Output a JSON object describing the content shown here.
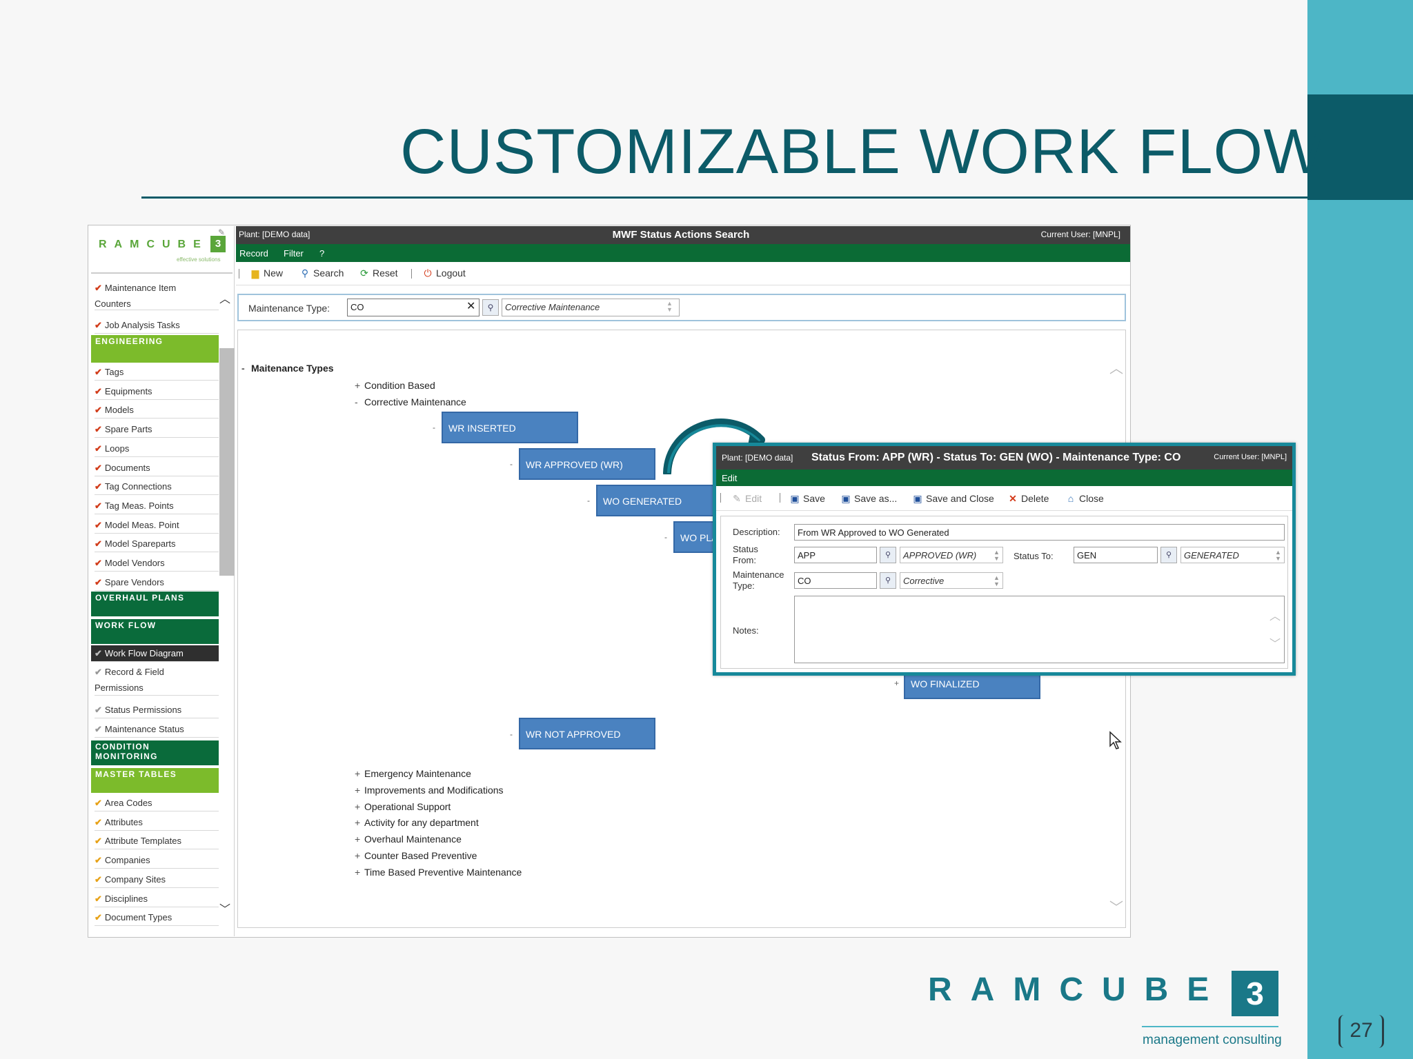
{
  "slide": {
    "title": "CUSTOMIZABLE WORK FLOW",
    "footer_logo_letters": "RAMCUBE",
    "footer_logo_cube": "3",
    "footer_tagline": "management consulting",
    "page_number": "27"
  },
  "colors": {
    "teal_dark": "#0c5b68",
    "teal_light": "#4db6c6",
    "green_dark": "#0b6b35",
    "green_light": "#7cbb2b",
    "node_blue": "#4a82c0"
  },
  "sidebar": {
    "logo_letters": "RAMCUBE",
    "logo_cube": "3",
    "logo_tag": "effective solutions",
    "items_top": [
      {
        "label": "Maintenance Item",
        "label2": "Counters"
      },
      {
        "label": "Job Analysis Tasks"
      }
    ],
    "engineering_heading": "ENGINEERING",
    "engineering_items": [
      "Tags",
      "Equipments",
      "Models",
      "Spare Parts",
      "Loops",
      "Documents",
      "Tag Connections",
      "Tag Meas. Points",
      "Model Meas. Point",
      "Model Spareparts",
      "Model Vendors",
      "Spare Vendors"
    ],
    "overhaul_heading": "OVERHAUL PLANS",
    "workflow_heading": "WORK FLOW",
    "workflow_items": [
      {
        "label": "Work Flow Diagram"
      },
      {
        "label": "Record & Field",
        "label2": "Permissions"
      },
      {
        "label": "Status Permissions"
      },
      {
        "label": "Maintenance Status"
      }
    ],
    "condition_heading_line1": "CONDITION",
    "condition_heading_line2": "MONITORING",
    "master_heading": "MASTER TABLES",
    "master_items": [
      "Area Codes",
      "Attributes",
      "Attribute Templates",
      "Companies",
      "Company Sites",
      "Disciplines",
      "Document Types"
    ]
  },
  "app": {
    "plant": "Plant: [DEMO data]",
    "title": "MWF Status Actions Search",
    "user": "Current User: [MNPL]",
    "menu": [
      "Record",
      "Filter",
      "?"
    ],
    "toolbar": {
      "new": "New",
      "search": "Search",
      "reset": "Reset",
      "logout": "Logout"
    },
    "filter": {
      "label": "Maintenance Type:",
      "code": "CO",
      "description": "Corrective Maintenance"
    }
  },
  "tree": {
    "root": "Maitenance Types",
    "condition_based": "Condition Based",
    "corrective": "Corrective Maintenance",
    "nodes": {
      "wr_inserted": "WR INSERTED",
      "wr_approved": "WR APPROVED (WR)",
      "wo_generated": "WO GENERATED",
      "wo_planned": "WO PLANNED",
      "wo_finalized": "WO FINALIZED",
      "wr_not_approved": "WR NOT APPROVED"
    },
    "other_types": [
      "Emergency Maintenance",
      "Improvements and Modifications",
      "Operational Support",
      "Activity for any department",
      "Overhaul Maintenance",
      "Counter Based Preventive",
      "Time Based Preventive Maintenance"
    ]
  },
  "dialog": {
    "plant": "Plant: [DEMO data]",
    "title": "Status From: APP (WR) - Status To: GEN (WO) - Maintenance Type: CO",
    "user": "Current User: [MNPL]",
    "menu": "Edit",
    "toolbar": {
      "edit": "Edit",
      "save": "Save",
      "save_as": "Save as...",
      "save_close": "Save and Close",
      "delete": "Delete",
      "close": "Close"
    },
    "form": {
      "description_label": "Description:",
      "description_value": "From WR Approved to WO Generated",
      "status_from_label1": "Status",
      "status_from_label2": "From:",
      "status_from_code": "APP",
      "status_from_desc": "APPROVED (WR)",
      "status_to_label": "Status To:",
      "status_to_code": "GEN",
      "status_to_desc": "GENERATED",
      "mtype_label1": "Maintenance",
      "mtype_label2": "Type:",
      "mtype_code": "CO",
      "mtype_desc": "Corrective",
      "notes_label": "Notes:"
    }
  }
}
